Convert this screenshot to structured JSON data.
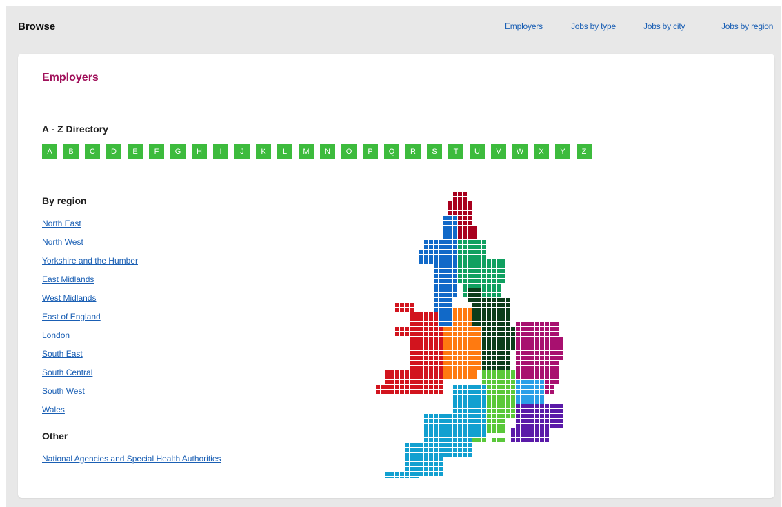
{
  "header": {
    "title": "Browse",
    "nav": [
      "Employers",
      "Jobs by type",
      "Jobs by city",
      "Jobs by region"
    ]
  },
  "card": {
    "title": "Employers",
    "az_heading": "A - Z Directory",
    "letters": [
      "A",
      "B",
      "C",
      "D",
      "E",
      "F",
      "G",
      "H",
      "I",
      "J",
      "K",
      "L",
      "M",
      "N",
      "O",
      "P",
      "Q",
      "R",
      "S",
      "T",
      "U",
      "V",
      "W",
      "X",
      "Y",
      "Z"
    ],
    "by_region_heading": "By region",
    "regions": [
      "North East",
      "North West",
      "Yorkshire and the Humber",
      "East Midlands",
      "West Midlands",
      "East of England",
      "London",
      "South East",
      "South Central",
      "South West",
      "Wales"
    ],
    "other_heading": "Other",
    "other_links": [
      "National Agencies and Special Health Authorities"
    ]
  },
  "map": {
    "region_colors": {
      "North East": "#a8001e",
      "North West": "#1169c8",
      "Yorkshire and the Humber": "#10a060",
      "East Midlands": "#0b3d1a",
      "West Midlands": "#ff7a10",
      "East of England": "#a8106f",
      "London": "#2a9fe8",
      "South East": "#5a1aa8",
      "South Central": "#5ac83a",
      "South West": "#12a0d0",
      "Wales": "#d2141e"
    },
    "accent": "#3dbb3d",
    "link_color": "#1a5fb4",
    "title_color": "#a0105a"
  }
}
